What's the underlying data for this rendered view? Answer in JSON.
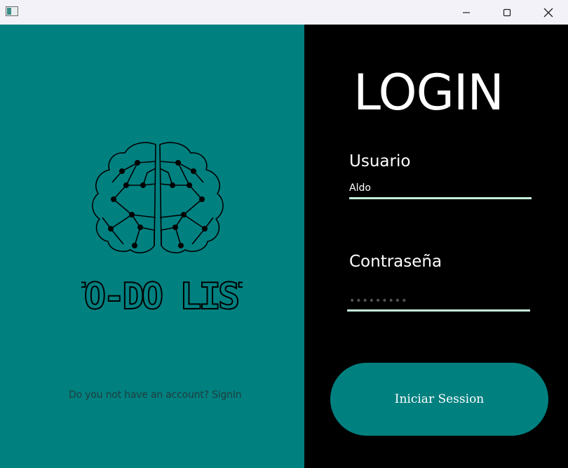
{
  "window": {
    "minimize_label": "Minimize",
    "maximize_label": "Maximize",
    "close_label": "Close"
  },
  "colors": {
    "accent": "#018080",
    "underline": "#c5f0dc",
    "background": "#000000"
  },
  "logo": {
    "text": "TO-DO LIST",
    "icon": "brain-icon"
  },
  "signin": {
    "text": "Do you not have an account? SignIn"
  },
  "login": {
    "title": "LOGIN",
    "user_label": "Usuario",
    "user_value": "Aldo",
    "password_label": "Contraseña",
    "password_value": "•••••••••",
    "button_label": "Iniciar Session"
  }
}
